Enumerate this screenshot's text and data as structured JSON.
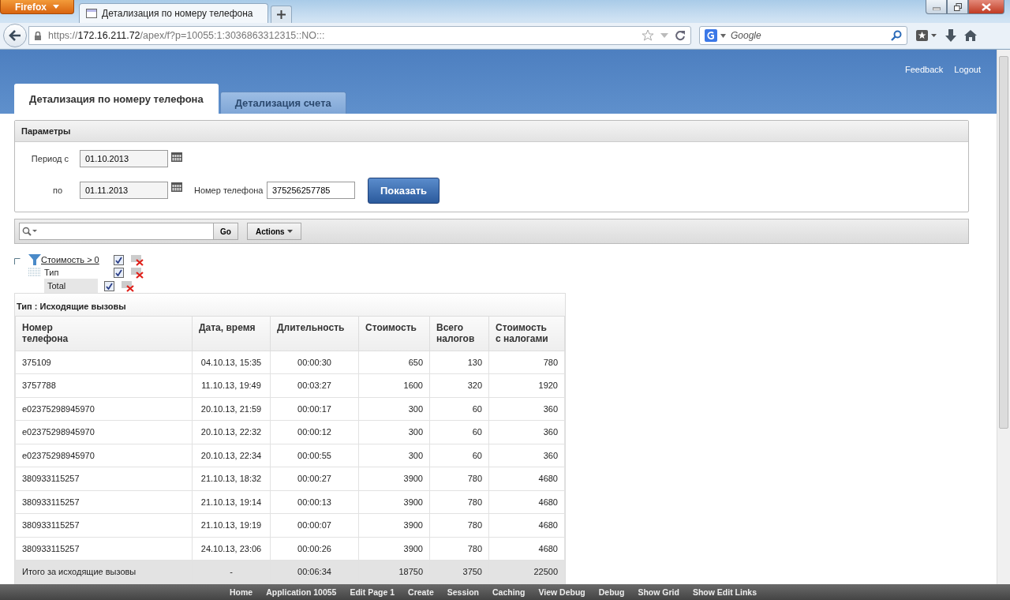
{
  "browser": {
    "menu_button": "Firefox",
    "tabs": [
      {
        "title": "Детализация по номеру телефона",
        "selected": true
      }
    ],
    "url": {
      "prefix": "https://",
      "host": "172.16.211.72",
      "path": "/apex/f?p=10055:1:3036863312315::NO:::"
    },
    "search": {
      "placeholder": "Google"
    }
  },
  "header": {
    "links": [
      "Feedback",
      "Logout"
    ],
    "tabs": [
      {
        "label": "Детализация по номеру телефона",
        "selected": true
      },
      {
        "label": "Детализация счета",
        "selected": false
      }
    ]
  },
  "parameters": {
    "title": "Параметры",
    "period_from": {
      "label": "Период с",
      "value": "01.10.2013"
    },
    "period_to": {
      "label": "по",
      "value": "01.11.2013"
    },
    "phone": {
      "label": "Номер телефона",
      "value": "375256257785"
    },
    "submit": "Показать"
  },
  "toolbar": {
    "go": "Go",
    "actions": "Actions"
  },
  "filters": [
    {
      "kind": "filter",
      "label": "Стоимость > 0",
      "checked": true
    },
    {
      "kind": "group",
      "label": "Тип",
      "checked": true
    },
    {
      "kind": "total",
      "label": "Total",
      "checked": true
    }
  ],
  "report": {
    "group_title": "Тип : Исходящие вызовы",
    "columns": [
      "Номер\nтелефона",
      "Дата, время",
      "Длительность",
      "Стоимость",
      "Всего\nналогов",
      "Стоимость\nс налогами"
    ],
    "rows": [
      [
        "375109",
        "04.10.13, 15:35",
        "00:00:30",
        "650",
        "130",
        "780"
      ],
      [
        "3757788",
        "11.10.13, 19:49",
        "00:03:27",
        "1600",
        "320",
        "1920"
      ],
      [
        "e02375298945970",
        "20.10.13, 21:59",
        "00:00:17",
        "300",
        "60",
        "360"
      ],
      [
        "e02375298945970",
        "20.10.13, 22:32",
        "00:00:12",
        "300",
        "60",
        "360"
      ],
      [
        "e02375298945970",
        "20.10.13, 22:34",
        "00:00:55",
        "300",
        "60",
        "360"
      ],
      [
        "380933115257",
        "21.10.13, 18:32",
        "00:00:27",
        "3900",
        "780",
        "4680"
      ],
      [
        "380933115257",
        "21.10.13, 19:14",
        "00:00:13",
        "3900",
        "780",
        "4680"
      ],
      [
        "380933115257",
        "21.10.13, 19:19",
        "00:00:07",
        "3900",
        "780",
        "4680"
      ],
      [
        "380933115257",
        "24.10.13, 23:06",
        "00:00:26",
        "3900",
        "780",
        "4680"
      ]
    ],
    "total": [
      "Итого за исходящие вызовы",
      "-",
      "00:06:34",
      "18750",
      "3750",
      "22500"
    ]
  },
  "dev_toolbar": [
    "Home",
    "Application 10055",
    "Edit Page 1",
    "Create",
    "Session",
    "Caching",
    "View Debug",
    "Debug",
    "Show Grid",
    "Show Edit Links"
  ]
}
